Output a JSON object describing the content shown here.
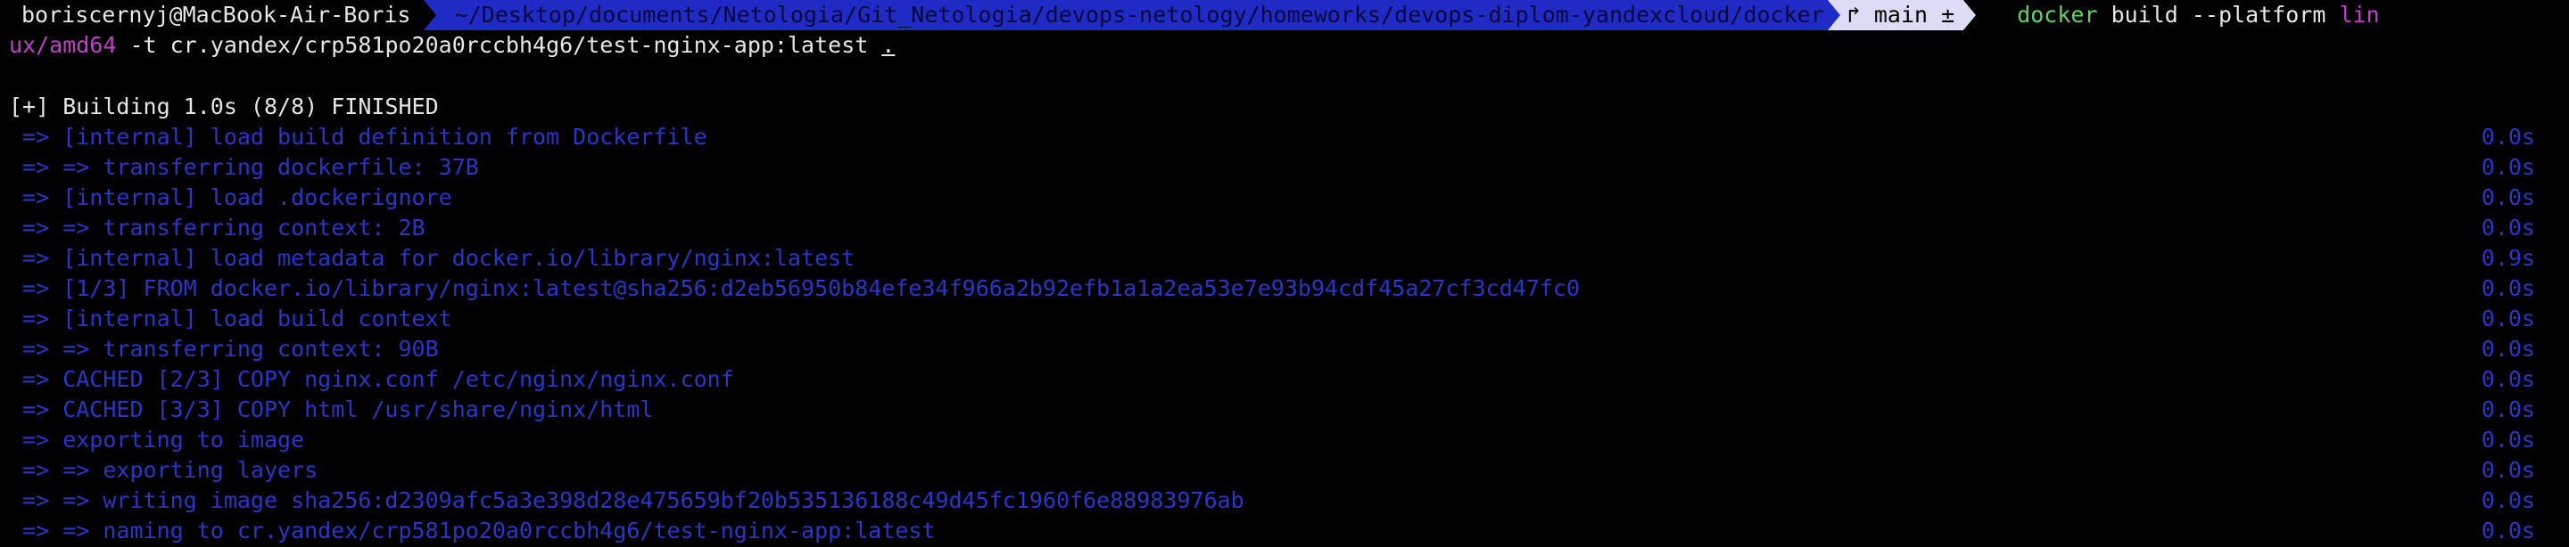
{
  "prompt": {
    "user_host": "boriscernyj@MacBook-Air-Boris",
    "cwd": " ~/Desktop/documents/Netologia/Git_Netologia/devops-netology/homeworks/devops-diplom-yandexcloud/docker",
    "git_branch": "↱ main ±",
    "command_name": "docker",
    "command_args": " build --platform ",
    "command_wrap_1": "lin",
    "command_wrap_2": "ux/amd64",
    "command_rest": " -t cr.yandex/crp581po20a0rccbh4g6/test-nginx-app:latest ",
    "command_dot": "."
  },
  "build_header": "[+] Building 1.0s (8/8) FINISHED",
  "steps": [
    {
      "text": " => [internal] load build definition from Dockerfile",
      "time": "0.0s"
    },
    {
      "text": " => => transferring dockerfile: 37B",
      "time": "0.0s"
    },
    {
      "text": " => [internal] load .dockerignore",
      "time": "0.0s"
    },
    {
      "text": " => => transferring context: 2B",
      "time": "0.0s"
    },
    {
      "text": " => [internal] load metadata for docker.io/library/nginx:latest",
      "time": "0.9s"
    },
    {
      "text": " => [1/3] FROM docker.io/library/nginx:latest@sha256:d2eb56950b84efe34f966a2b92efb1a1a2ea53e7e93b94cdf45a27cf3cd47fc0",
      "time": "0.0s"
    },
    {
      "text": " => [internal] load build context",
      "time": "0.0s"
    },
    {
      "text": " => => transferring context: 90B",
      "time": "0.0s"
    },
    {
      "text": " => CACHED [2/3] COPY nginx.conf /etc/nginx/nginx.conf",
      "time": "0.0s"
    },
    {
      "text": " => CACHED [3/3] COPY html /usr/share/nginx/html",
      "time": "0.0s"
    },
    {
      "text": " => exporting to image",
      "time": "0.0s"
    },
    {
      "text": " => => exporting layers",
      "time": "0.0s"
    },
    {
      "text": " => => writing image sha256:d2309afc5a3e398d28e475659bf20b535136188c49d45fc1960f6e88983976ab",
      "time": "0.0s"
    },
    {
      "text": " => => naming to cr.yandex/crp581po20a0rccbh4g6/test-nginx-app:latest",
      "time": "0.0s"
    }
  ],
  "colors": {
    "background": "#000000",
    "dir_segment": "#1f2bc4",
    "git_segment": "#dcdcf4",
    "command_green": "#5fd35f",
    "wrap_magenta": "#c040c8",
    "step_blue": "#2a36c8"
  }
}
